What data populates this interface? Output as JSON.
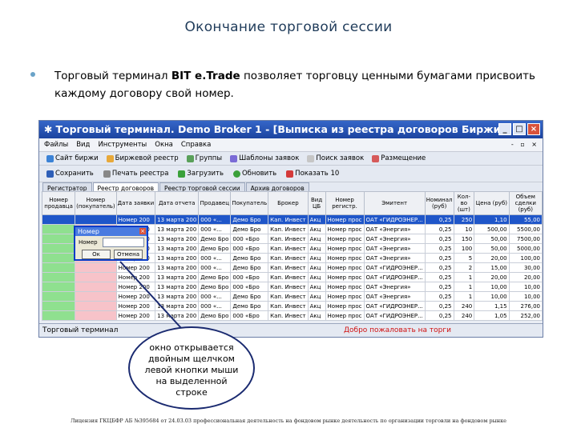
{
  "slide": {
    "title": "Окончание торговой сессии",
    "bullet_pre": "Торговый терминал ",
    "bullet_brand": "BIT e.Trade",
    "bullet_post": " позволяет торговцу ценными бумагами присвоить каждому договору свой номер."
  },
  "window": {
    "title": "Торговый терминал. Demo Broker 1 - [Выписка из реестра договоров Биржи]",
    "controls": [
      "_",
      "□",
      "×"
    ],
    "menu": [
      "Файлы",
      "Вид",
      "Инструменты",
      "Окна",
      "Справка"
    ],
    "menu_right": "- ▫ ×",
    "toolbar1": [
      "Сайт биржи",
      "Биржевой реестр",
      "Группы",
      "Шаблоны заявок",
      "Поиск заявок",
      "Размещение"
    ],
    "toolbar2": [
      "Сохранить",
      "Печать реестра",
      "Загрузить",
      "Обновить",
      "Показать 10"
    ],
    "tabs": [
      "Регистратор",
      "Реестр договоров",
      "Реестр торговой сессии",
      "Архив договоров"
    ],
    "active_tab": 1,
    "columns": [
      "Номер продавца",
      "Номер (покупатель)",
      "Дата заявки",
      "Дата отчета",
      "Продавец",
      "Покупатель",
      "Брокер",
      "Вид ЦБ",
      "Номер регистр.",
      "Эмитент",
      "Номинал (руб)",
      "Кол-во (шт)",
      "Цена (руб)",
      "Объем сделки (руб)"
    ],
    "rows": [
      {
        "sel": true,
        "c": [
          "",
          "",
          "Номер 200",
          "13 марта 200",
          "000 «...",
          "Демо Бро",
          "Кап. Инвест",
          "Акц",
          "Номер прос",
          "ОАТ «ГИДРОЭНЕР...",
          "0,25",
          "250",
          "1,10",
          "55,00"
        ]
      },
      {
        "sel": false,
        "c": [
          "",
          "",
          "Номер 200",
          "13 марта 200",
          "000 «...",
          "Демо Бро",
          "Кап. Инвест",
          "Акц",
          "Номер прос",
          "ОАТ «Энергия»",
          "0,25",
          "10",
          "500,00",
          "5500,00"
        ]
      },
      {
        "sel": false,
        "c": [
          "",
          "",
          "Номер 200",
          "13 марта 200",
          "Демо Бро",
          "000 «Бро",
          "Кап. Инвест",
          "Акц",
          "Номер прос",
          "ОАТ «Энергия»",
          "0,25",
          "150",
          "50,00",
          "7500,00"
        ]
      },
      {
        "sel": false,
        "c": [
          "",
          "",
          "Номер 200",
          "13 марта 200",
          "Демо Бро",
          "000 «Бро",
          "Кап. Инвест",
          "Акц",
          "Номер прос",
          "ОАТ «Энергия»",
          "0,25",
          "100",
          "50,00",
          "5000,00"
        ]
      },
      {
        "sel": false,
        "c": [
          "",
          "",
          "Номер 200",
          "13 марта 200",
          "000 «...",
          "Демо Бро",
          "Кап. Инвест",
          "Акц",
          "Номер прос",
          "ОАТ «Энергия»",
          "0,25",
          "5",
          "20,00",
          "100,00"
        ]
      },
      {
        "sel": false,
        "c": [
          "",
          "",
          "Номер 200",
          "13 марта 200",
          "000 «...",
          "Демо Бро",
          "Кап. Инвест",
          "Акц",
          "Номер прос",
          "ОАТ «ГИДРОЭНЕР...",
          "0,25",
          "2",
          "15,00",
          "30,00"
        ]
      },
      {
        "sel": false,
        "c": [
          "",
          "",
          "Номер 200",
          "13 марта 200",
          "Демо Бро",
          "000 «Бро",
          "Кап. Инвест",
          "Акц",
          "Номер прос",
          "ОАТ «ГИДРОЭНЕР...",
          "0,25",
          "1",
          "20,00",
          "20,00"
        ]
      },
      {
        "sel": false,
        "c": [
          "",
          "",
          "Номер 200",
          "13 марта 200",
          "Демо Бро",
          "000 «Бро",
          "Кап. Инвест",
          "Акц",
          "Номер прос",
          "ОАТ «Энергия»",
          "0,25",
          "1",
          "10,00",
          "10,00"
        ]
      },
      {
        "sel": false,
        "c": [
          "",
          "",
          "Номер 200",
          "13 марта 200",
          "000 «...",
          "Демо Бро",
          "Кап. Инвест",
          "Акц",
          "Номер прос",
          "ОАТ «Энергия»",
          "0,25",
          "1",
          "10,00",
          "10,00"
        ]
      },
      {
        "sel": false,
        "c": [
          "",
          "",
          "Номер 200",
          "13 марта 200",
          "000 «...",
          "Демо Бро",
          "Кап. Инвест",
          "Акц",
          "Номер прос",
          "ОАТ «ГИДРОЭНЕР...",
          "0,25",
          "240",
          "1,15",
          "276,00"
        ]
      },
      {
        "sel": false,
        "c": [
          "",
          "",
          "Номер 200",
          "13 марта 200",
          "Демо Бро",
          "000 «Бро",
          "Кап. Инвест",
          "Акц",
          "Номер прос",
          "ОАТ «ГИДРОЭНЕР...",
          "0,25",
          "240",
          "1,05",
          "252,00"
        ]
      }
    ],
    "status_left": "Торговый терминал",
    "status_right": "Добро пожаловать на торги"
  },
  "dialog": {
    "title": "Номер",
    "close": "×",
    "label": "Номер",
    "ok": "Ок",
    "cancel": "Отмена"
  },
  "callout": {
    "lines": [
      "окно открывается",
      "двойным щелчком",
      "левой кнопки мыши",
      "на выделенной",
      "строке"
    ]
  },
  "footer": "Лицензия ГКЦБФР АБ №395684 от 24.03.03 профессиональная деятельность на фондовом рынке деятельность по организации торговли на фондовом рынке",
  "colors": {
    "row_green": "#8fe08f",
    "row_pink": "#f7c3c9",
    "selection": "#1f56c9",
    "status_red": "#d01010"
  }
}
